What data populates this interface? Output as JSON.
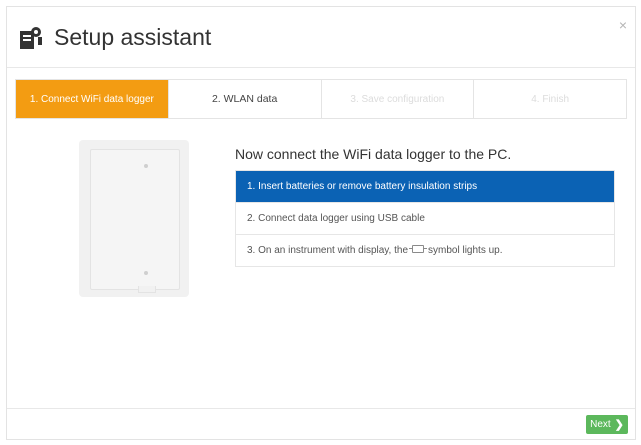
{
  "dialog": {
    "title": "Setup assistant",
    "close_label": "×"
  },
  "steps": [
    {
      "label": "1. Connect WiFi data logger",
      "state": "active"
    },
    {
      "label": "2. WLAN data",
      "state": "normal"
    },
    {
      "label": "3. Save configuration",
      "state": "disabled"
    },
    {
      "label": "4. Finish",
      "state": "disabled"
    }
  ],
  "content": {
    "heading": "Now connect the WiFi data logger to the PC.",
    "instructions": [
      "1. Insert batteries or remove battery insulation strips",
      "2. Connect data logger using USB cable",
      {
        "before": "3. On an instrument with display, the",
        "after": "symbol lights up."
      }
    ]
  },
  "footer": {
    "next_label": "Next",
    "next_chevron": "❯"
  },
  "colors": {
    "accent_orange": "#f39c12",
    "selected_blue": "#0b62b4",
    "button_green": "#5cb85c"
  }
}
